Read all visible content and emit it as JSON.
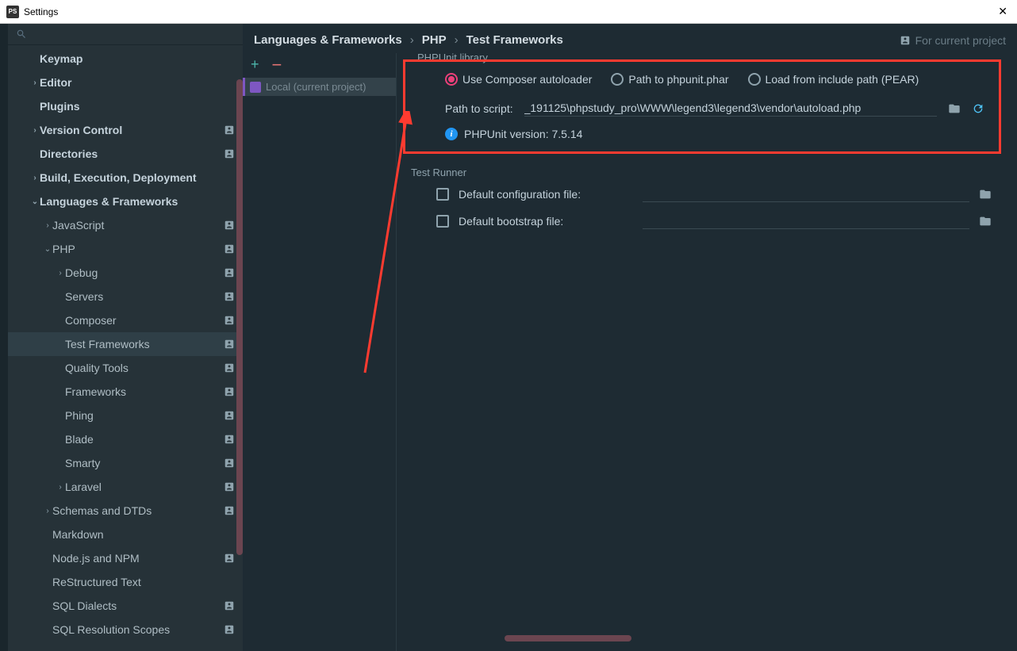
{
  "titlebar": {
    "title": "Settings",
    "appIcon": "PS"
  },
  "sidebar": {
    "items": [
      {
        "label": "Keymap",
        "indent": 40,
        "bold": true,
        "arrow": ""
      },
      {
        "label": "Editor",
        "indent": 40,
        "bold": true,
        "arrow": "›"
      },
      {
        "label": "Plugins",
        "indent": 40,
        "bold": true,
        "arrow": ""
      },
      {
        "label": "Version Control",
        "indent": 40,
        "bold": true,
        "arrow": "›",
        "proj": true
      },
      {
        "label": "Directories",
        "indent": 40,
        "bold": true,
        "arrow": "",
        "proj": true
      },
      {
        "label": "Build, Execution, Deployment",
        "indent": 40,
        "bold": true,
        "arrow": "›"
      },
      {
        "label": "Languages & Frameworks",
        "indent": 40,
        "bold": true,
        "arrow": "⌄"
      },
      {
        "label": "JavaScript",
        "indent": 56,
        "arrow": "›",
        "proj": true
      },
      {
        "label": "PHP",
        "indent": 56,
        "arrow": "⌄",
        "proj": true
      },
      {
        "label": "Debug",
        "indent": 72,
        "arrow": "›",
        "proj": true
      },
      {
        "label": "Servers",
        "indent": 72,
        "arrow": "",
        "proj": true
      },
      {
        "label": "Composer",
        "indent": 72,
        "arrow": "",
        "proj": true
      },
      {
        "label": "Test Frameworks",
        "indent": 72,
        "arrow": "",
        "proj": true,
        "selected": true
      },
      {
        "label": "Quality Tools",
        "indent": 72,
        "arrow": "",
        "proj": true
      },
      {
        "label": "Frameworks",
        "indent": 72,
        "arrow": "",
        "proj": true
      },
      {
        "label": "Phing",
        "indent": 72,
        "arrow": "",
        "proj": true
      },
      {
        "label": "Blade",
        "indent": 72,
        "arrow": "",
        "proj": true
      },
      {
        "label": "Smarty",
        "indent": 72,
        "arrow": "",
        "proj": true
      },
      {
        "label": "Laravel",
        "indent": 72,
        "arrow": "›",
        "proj": true
      },
      {
        "label": "Schemas and DTDs",
        "indent": 56,
        "arrow": "›",
        "proj": true
      },
      {
        "label": "Markdown",
        "indent": 56,
        "arrow": ""
      },
      {
        "label": "Node.js and NPM",
        "indent": 56,
        "arrow": "",
        "proj": true
      },
      {
        "label": "ReStructured Text",
        "indent": 56,
        "arrow": ""
      },
      {
        "label": "SQL Dialects",
        "indent": 56,
        "arrow": "",
        "proj": true
      },
      {
        "label": "SQL Resolution Scopes",
        "indent": 56,
        "arrow": "",
        "proj": true
      }
    ]
  },
  "breadcrumb": {
    "a": "Languages & Frameworks",
    "b": "PHP",
    "c": "Test Frameworks",
    "scope": "For current project"
  },
  "list": {
    "item": "Local (current project)"
  },
  "phpunit": {
    "legend": "PHPUnit library",
    "radio1": "Use Composer autoloader",
    "radio2": "Path to phpunit.phar",
    "radio3": "Load from include path (PEAR)",
    "pathLabel": "Path to script:",
    "pathValue": "_191125\\phpstudy_pro\\WWW\\legend3\\legend3\\vendor\\autoload.php",
    "version": "PHPUnit version: 7.5.14"
  },
  "runner": {
    "legend": "Test Runner",
    "cfg": "Default configuration file:",
    "boot": "Default bootstrap file:"
  }
}
